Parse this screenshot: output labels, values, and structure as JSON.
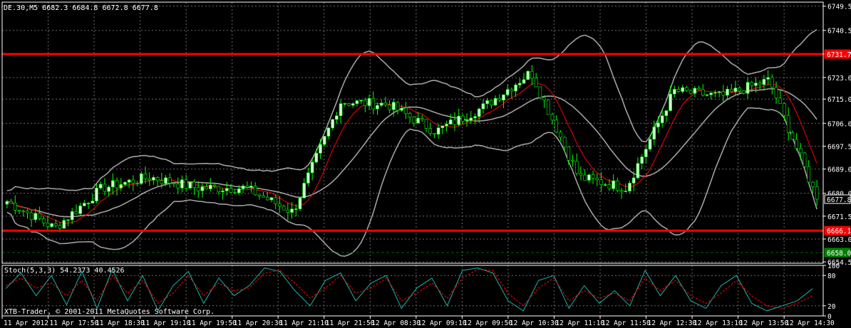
{
  "main_panel": {
    "title": "DE.30,M5  6682.3 6684.8 6672.8 6677.8",
    "levels": [
      {
        "label": "6731.7",
        "value": 6731.7,
        "color": "#ff0000"
      },
      {
        "label": "6666.1",
        "value": 6666.1,
        "color": "#ff0000"
      },
      {
        "label": "6677.8",
        "value": 6677.8,
        "color": "#000000"
      },
      {
        "label": "6658.0",
        "value": 6658.0,
        "color": "#008000"
      }
    ]
  },
  "stoch_panel": {
    "title": "Stoch(5,3,3) 54.2373 40.4526",
    "y_ticks": [
      "100",
      "80",
      "20",
      "0"
    ]
  },
  "footer": {
    "copyright": "XTB-Trader, © 2001-2011 MetaQuotes Software Corp."
  },
  "colors": {
    "background": "#000000",
    "grid": "#6a6a6a",
    "bull_candle": "#ccffcc",
    "bear_candle": "#000000",
    "candle_outline": "#00ff00",
    "bollinger": "#a0a0a0",
    "moving_average": "#ff0000",
    "stoch_main": "#20b2aa",
    "stoch_signal": "#ff0000"
  },
  "chart_data": [
    {
      "type": "candlestick",
      "symbol": "DE.30",
      "timeframe": "M5",
      "ohlc_last": {
        "open": 6682.3,
        "high": 6684.8,
        "low": 6672.8,
        "close": 6677.8
      },
      "ylim": [
        6654.0,
        6751.0
      ],
      "y_ticks": [
        6749.5,
        6740.5,
        6731.7,
        6723.0,
        6715.0,
        6706.0,
        6697.5,
        6689.0,
        6680.0,
        6671.5,
        6663.0,
        6654.5
      ],
      "y_tick_labels": [
        "6749.5",
        "6740.5",
        "6731.7",
        "6723.0",
        "6715.0",
        "6706.0",
        "6697.5",
        "6689.0",
        "6680.0",
        "6671.5",
        "6663.0",
        "6654.5"
      ],
      "x_tick_labels": [
        "11 Apr 2012",
        "11 Apr 17:50",
        "11 Apr 18:30",
        "11 Apr 19:10",
        "11 Apr 19:50",
        "11 Apr 20:30",
        "11 Apr 21:10",
        "11 Apr 21:50",
        "12 Apr 08:30",
        "12 Apr 09:10",
        "12 Apr 09:50",
        "12 Apr 10:30",
        "12 Apr 11:10",
        "12 Apr 11:50",
        "12 Apr 12:30",
        "12 Apr 13:10",
        "12 Apr 13:50",
        "12 Apr 14:30"
      ],
      "horizontal_levels": [
        6731.7,
        6666.1
      ],
      "indicators": [
        "Bollinger Bands",
        "Moving Average"
      ],
      "close_path": [
        {
          "x": "11 Apr 2012",
          "y": 6677
        },
        {
          "x": "11 Apr 17:50",
          "y": 6667
        },
        {
          "x": "11 Apr 18:30",
          "y": 6682
        },
        {
          "x": "11 Apr 19:10",
          "y": 6686
        },
        {
          "x": "11 Apr 19:50",
          "y": 6682
        },
        {
          "x": "11 Apr 20:30",
          "y": 6682
        },
        {
          "x": "11 Apr 21:10",
          "y": 6673
        },
        {
          "x": "11 Apr 21:50",
          "y": 6714
        },
        {
          "x": "12 Apr 08:30",
          "y": 6713
        },
        {
          "x": "12 Apr 09:10",
          "y": 6703
        },
        {
          "x": "12 Apr 09:50",
          "y": 6712
        },
        {
          "x": "12 Apr 10:30",
          "y": 6725
        },
        {
          "x": "12 Apr 11:10",
          "y": 6686
        },
        {
          "x": "12 Apr 11:50",
          "y": 6682
        },
        {
          "x": "12 Apr 12:30",
          "y": 6718
        },
        {
          "x": "12 Apr 13:10",
          "y": 6716
        },
        {
          "x": "12 Apr 13:50",
          "y": 6722
        },
        {
          "x": "12 Apr 14:30",
          "y": 6678
        }
      ]
    },
    {
      "type": "line",
      "name": "Stoch(5,3,3)",
      "ylim": [
        0,
        100
      ],
      "y_ticks": [
        100,
        80,
        20,
        0
      ],
      "last_values": {
        "main": 54.2373,
        "signal": 40.4526
      },
      "series": [
        {
          "name": "main",
          "values": [
            54,
            85,
            40,
            80,
            22,
            88,
            15,
            92,
            30,
            80,
            10,
            60,
            88,
            25,
            75,
            40,
            60,
            95,
            88,
            50,
            20,
            70,
            85,
            30,
            65,
            80,
            15,
            55,
            75,
            20,
            90,
            95,
            85,
            30,
            10,
            70,
            80,
            15,
            60,
            25,
            50,
            20,
            90,
            40,
            80,
            30,
            15,
            60,
            80,
            25,
            10,
            20,
            30,
            54
          ]
        },
        {
          "name": "signal",
          "values": [
            60,
            75,
            55,
            65,
            40,
            70,
            30,
            80,
            45,
            70,
            25,
            45,
            80,
            40,
            65,
            50,
            55,
            85,
            90,
            65,
            35,
            55,
            80,
            45,
            55,
            75,
            30,
            45,
            65,
            35,
            75,
            92,
            90,
            45,
            20,
            55,
            75,
            30,
            50,
            35,
            45,
            30,
            75,
            50,
            70,
            40,
            25,
            45,
            70,
            40,
            20,
            15,
            25,
            40
          ]
        }
      ]
    }
  ]
}
